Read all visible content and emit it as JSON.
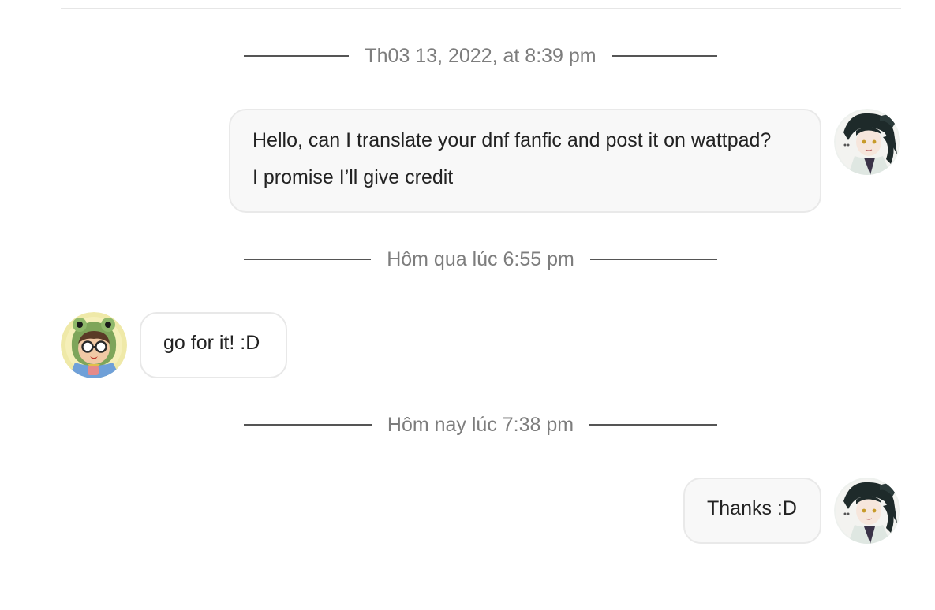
{
  "conversation": {
    "dividers": [
      {
        "label": "Th03 13, 2022, at 8:39 pm"
      },
      {
        "label": "Hôm qua lúc 6:55 pm"
      },
      {
        "label": "Hôm nay lúc 7:38 pm"
      }
    ],
    "messages": [
      {
        "direction": "outgoing",
        "lines": [
          "Hello, can I translate your dnf fanfic and post it on wattpad?",
          "I promise I’ll give credit"
        ],
        "avatar": "anime-character-avatar-icon"
      },
      {
        "direction": "incoming",
        "lines": [
          "go for it! :D"
        ],
        "avatar": "frog-hood-character-avatar-icon"
      },
      {
        "direction": "outgoing",
        "lines": [
          "Thanks :D"
        ],
        "avatar": "anime-character-avatar-icon"
      }
    ]
  },
  "colors": {
    "timestamp_text": "#7d7d7d",
    "divider_line": "#555555",
    "bubble_outgoing_bg": "#f8f8f8",
    "bubble_border": "#e9e9e9",
    "message_text": "#222222"
  }
}
